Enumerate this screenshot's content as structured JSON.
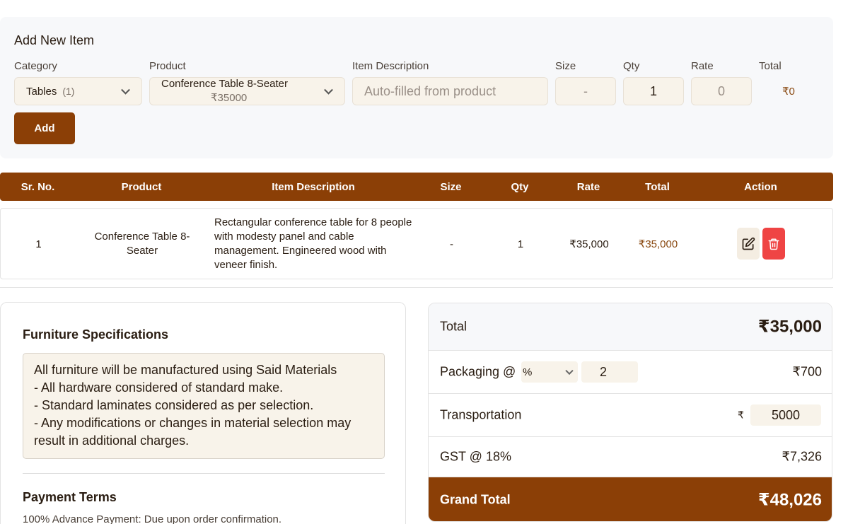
{
  "add_item": {
    "title": "Add New Item",
    "labels": {
      "category": "Category",
      "product": "Product",
      "description": "Item Description",
      "size": "Size",
      "qty": "Qty",
      "rate": "Rate",
      "total": "Total"
    },
    "category_value": "Tables",
    "category_count": "(1)",
    "product_name": "Conference Table 8-Seater",
    "product_price": "₹35000",
    "description_placeholder": "Auto-filled from product",
    "size_value": "-",
    "qty_value": "1",
    "rate_value": "0",
    "total_value": "₹0",
    "add_button": "Add"
  },
  "table": {
    "headers": [
      "Sr. No.",
      "Product",
      "Item Description",
      "Size",
      "Qty",
      "Rate",
      "Total",
      "Action"
    ],
    "rows": [
      {
        "sr": "1",
        "product": "Conference Table 8-Seater",
        "description": "Rectangular conference table for 8 people with modesty panel and cable management. Engineered wood with veneer finish.",
        "size": "-",
        "qty": "1",
        "rate": "₹35,000",
        "total": "₹35,000"
      }
    ]
  },
  "specs": {
    "title": "Furniture Specifications",
    "text": "All furniture will be manufactured using Said Materials\n- All hardware considered of standard make.\n- Standard laminates considered as per selection.\n- Any modifications or changes in material selection may result in additional charges.",
    "payment_title": "Payment Terms",
    "payment_text": "100% Advance Payment: Due upon order confirmation."
  },
  "summary": {
    "total_label": "Total",
    "total_value": "₹35,000",
    "packaging_label": "Packaging @",
    "packaging_unit": "%",
    "packaging_input": "2",
    "packaging_value": "₹700",
    "transport_label": "Transportation",
    "transport_currency": "₹",
    "transport_input": "5000",
    "gst_label": "GST @ 18%",
    "gst_value": "₹7,326",
    "grand_label": "Grand Total",
    "grand_value": "₹48,026"
  },
  "colors": {
    "brand": "#8b3f06",
    "delete": "#ef4444",
    "input_bg": "#f8f3ea"
  }
}
